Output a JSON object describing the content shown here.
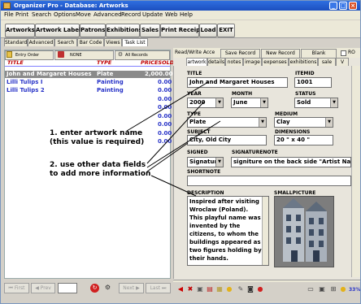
{
  "window": {
    "title": "Organizer Pro - Database: Artworks",
    "controls": [
      "_",
      "□",
      "×"
    ]
  },
  "menu": [
    "File",
    "Print",
    "Search",
    "Options",
    "Move",
    "Advanced",
    "Record",
    "Update",
    "Web",
    "Help"
  ],
  "toolbar": [
    "Artworks",
    "Artwork Labels",
    "Patrons",
    "Exhibitions",
    "Sales",
    "Print Receipt",
    "Load",
    "EXIT"
  ],
  "left_tabs": [
    "Standard",
    "Advanced",
    "Search",
    "Bar Code",
    "Views",
    "Task List"
  ],
  "left_buttons": [
    "Entry Order",
    "NONE",
    "All Records"
  ],
  "list": {
    "columns": [
      "TITLE",
      "TYPE",
      "PRICESOLD"
    ],
    "rows": [
      {
        "title": "John and Margaret Houses",
        "type": "Plate",
        "price": "2,000.00"
      },
      {
        "title": "Lilli Tulips I",
        "type": "Painting",
        "price": "0.00"
      },
      {
        "title": "Lilli Tulips 2",
        "type": "Painting",
        "price": "0.00"
      }
    ],
    "extra_prices": [
      "0.00",
      "0.00",
      "0.00",
      "0.00",
      "0.00",
      "0.00"
    ]
  },
  "record_bar": {
    "status": "Read/Write Acce",
    "save": "Save Record",
    "new": "New Record",
    "blank": "Blank",
    "ro": "RO"
  },
  "detail_tabs": [
    "artwork",
    "details",
    "notes",
    "image",
    "expenses",
    "exhibitions",
    "sale",
    "V"
  ],
  "form": {
    "title_label": "TITLE",
    "title_value": "John and Margaret Houses",
    "itemid_label": "ITEMID",
    "itemid_value": "1001",
    "year_label": "YEAR",
    "year_value": "2000",
    "month_label": "MONTH",
    "month_value": "June",
    "status_label": "STATUS",
    "status_value": "Sold",
    "type_label": "TYPE",
    "type_value": "Plate",
    "medium_label": "MEDIUM",
    "medium_value": "Clay",
    "subject_label": "SUBJECT",
    "subject_value": "City, Old City",
    "dimensions_label": "DIMENSIONS",
    "dimensions_value": "20 \" x 40 \"",
    "signed_label": "SIGNED",
    "signed_value": "Signature",
    "signaturenote_label": "SIGNATURENOTE",
    "signaturenote_value": "signiture on the back side \"Artist Name\"",
    "shortnote_label": "SHORTNOTE",
    "shortnote_value": "",
    "description_label": "DESCRIPTION",
    "description_lines": [
      "Inspired after visiting",
      "Wroclaw (Poland).",
      "This playful name was",
      "invented by the",
      "citizens, to whom the",
      "buildings appeared as",
      "two figures holding by",
      "their hands."
    ],
    "smallpicture_label": "SMALLPICTURE"
  },
  "annotations": {
    "note1_line1": "1. enter artwork name",
    "note1_line2": "(this value is required)",
    "note2_line1": "2. use other data fields",
    "note2_line2": "to add more information"
  },
  "nav_buttons": [
    "First",
    "Prev",
    "Next",
    "Last"
  ],
  "zoom": "33%"
}
